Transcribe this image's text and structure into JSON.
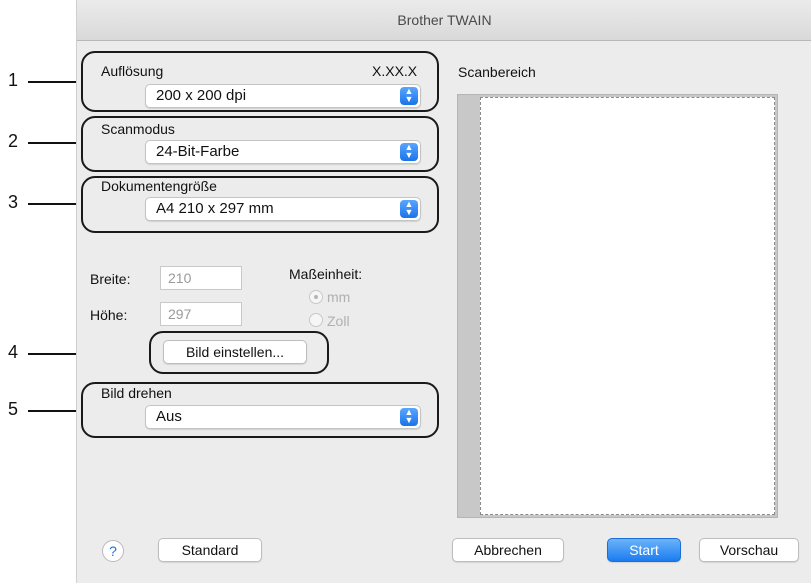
{
  "window": {
    "title": "Brother TWAIN"
  },
  "callouts": [
    "1",
    "2",
    "3",
    "4",
    "5"
  ],
  "resolution": {
    "label": "Auflösung",
    "version": "X.XX.X",
    "value": "200 x 200 dpi"
  },
  "scanmode": {
    "label": "Scanmodus",
    "value": "24-Bit-Farbe"
  },
  "docsize": {
    "label": "Dokumentengröße",
    "value": "A4  210 x 297 mm"
  },
  "dimensions": {
    "width_label": "Breite:",
    "width_value": "210",
    "height_label": "Höhe:",
    "height_value": "297",
    "unit_label": "Maßeinheit:",
    "unit_options": [
      "mm",
      "Zoll"
    ],
    "unit_selected": "mm"
  },
  "adjust_button": "Bild einstellen...",
  "rotate": {
    "label": "Bild drehen",
    "value": "Aus"
  },
  "scan_area": {
    "label": "Scanbereich"
  },
  "buttons": {
    "help": "?",
    "default": "Standard",
    "cancel": "Abbrechen",
    "start": "Start",
    "preview": "Vorschau"
  },
  "colors": {
    "accent": "#1b7cf0",
    "callout": "#111111"
  }
}
